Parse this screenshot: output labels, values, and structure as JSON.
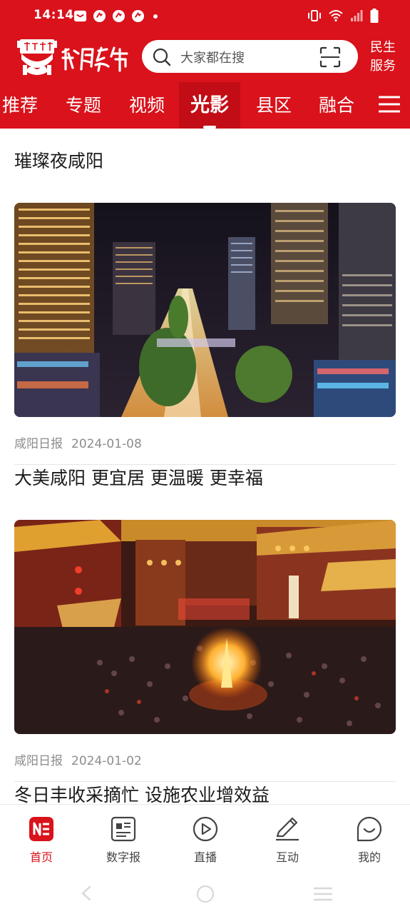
{
  "status_bar": {
    "time": "14:14"
  },
  "header": {
    "logo_text": "咸阳发布",
    "search_placeholder": "大家都在搜",
    "service_label_line1": "民生",
    "service_label_line2": "服务",
    "accent_color": "#d9121b"
  },
  "tabs": [
    {
      "label": "推荐",
      "active": false
    },
    {
      "label": "专题",
      "active": false
    },
    {
      "label": "视频",
      "active": false
    },
    {
      "label": "光影",
      "active": true
    },
    {
      "label": "县区",
      "active": false
    },
    {
      "label": "融合",
      "active": false
    }
  ],
  "articles": [
    {
      "title": "璀璨夜咸阳",
      "source": "咸阳日报",
      "date": "2024-01-08",
      "image": "city-night-aerial-photo"
    },
    {
      "title": "大美咸阳 更宜居 更温暖 更幸福",
      "source": "咸阳日报",
      "date": "2024-01-02",
      "image": "night-market-bonfire-crowd-photo"
    },
    {
      "title": "冬日丰收采摘忙 设施农业增效益"
    }
  ],
  "bottom_nav": [
    {
      "label": "首页",
      "icon": "home-news-icon",
      "active": true
    },
    {
      "label": "数字报",
      "icon": "newspaper-icon",
      "active": false
    },
    {
      "label": "直播",
      "icon": "play-icon",
      "active": false
    },
    {
      "label": "互动",
      "icon": "pen-icon",
      "active": false
    },
    {
      "label": "我的",
      "icon": "smile-face-icon",
      "active": false
    }
  ]
}
